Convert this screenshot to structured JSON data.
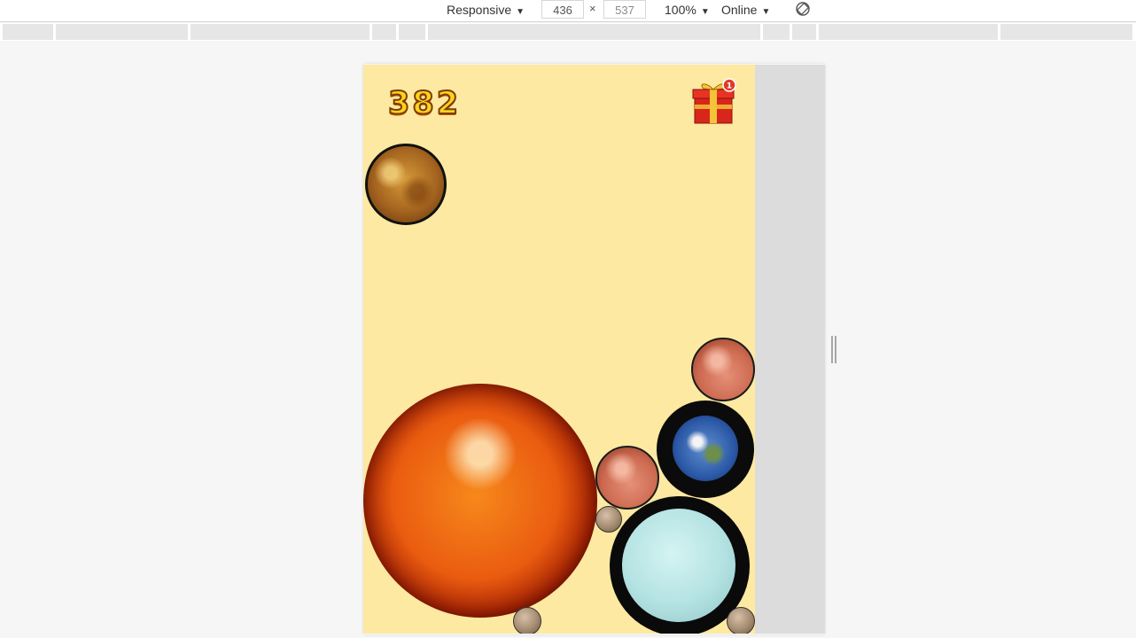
{
  "toolbar": {
    "device": "Responsive",
    "width": "436",
    "separator": "×",
    "height": "537",
    "zoom": "100%",
    "network": "Online",
    "dropdown_arrow": "▼",
    "rotate_icon": "rotate-icon"
  },
  "game": {
    "score": "382",
    "gift_badge": "1",
    "gift_icon": "gift-icon"
  },
  "colors": {
    "game_background": "#fde9a1",
    "score_fill": "#ffd21f",
    "badge": "#e23a2a"
  }
}
